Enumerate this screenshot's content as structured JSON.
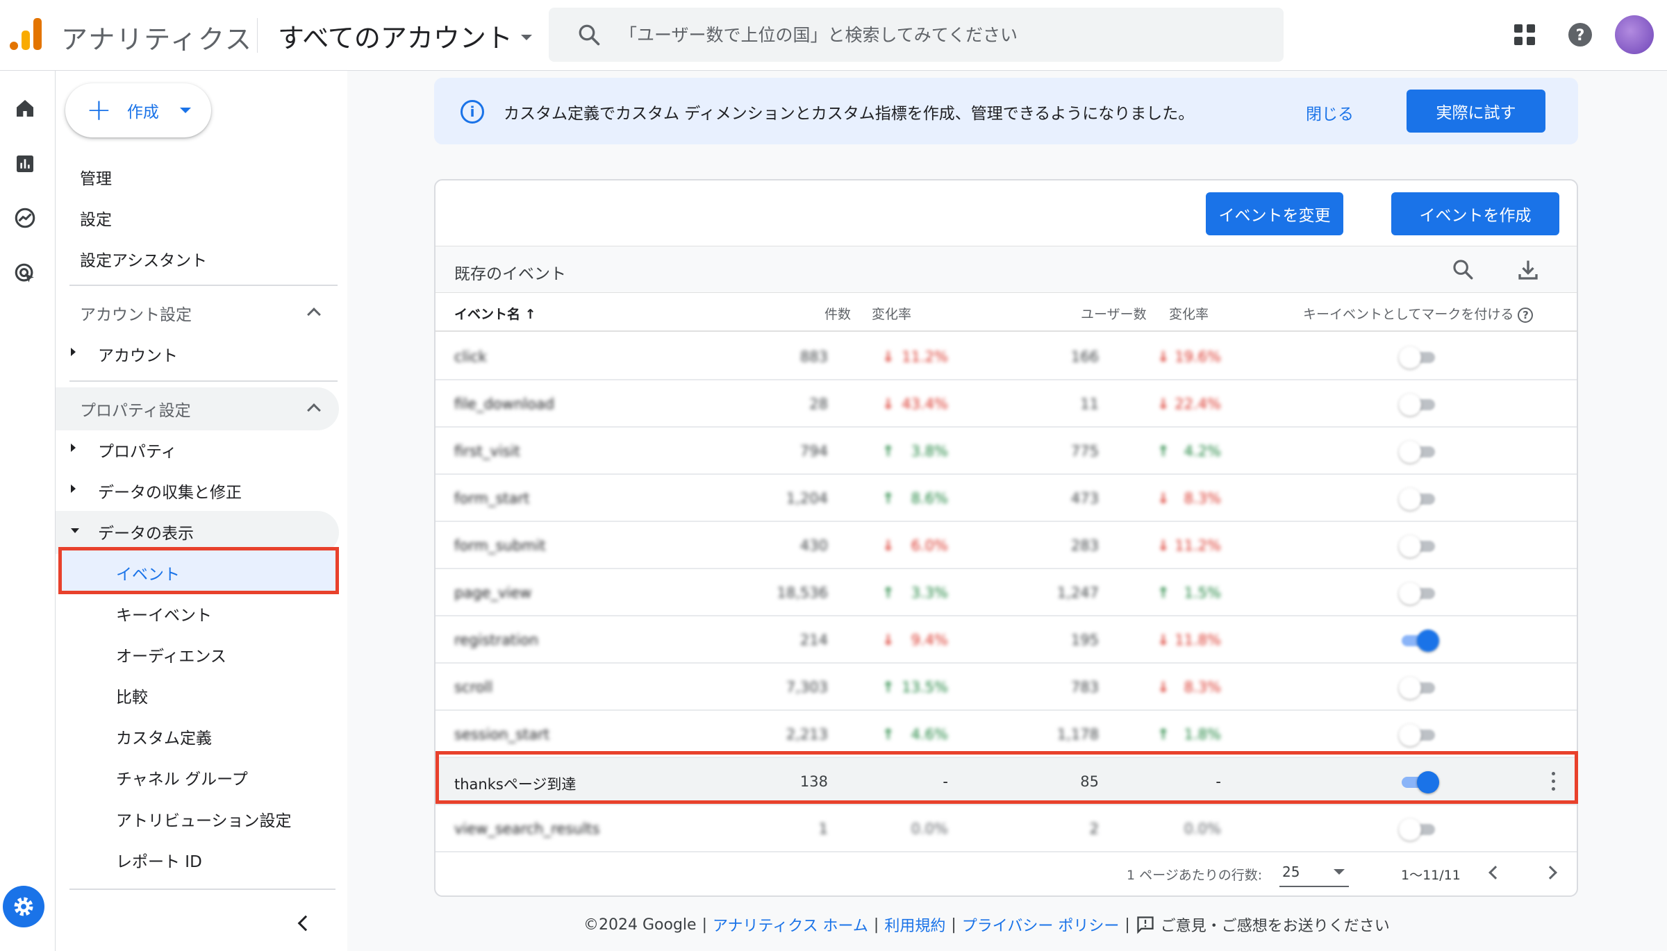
{
  "header": {
    "app_title": "アナリティクス",
    "account_picker": "すべてのアカウント",
    "search_placeholder": "「ユーザー数で上位の国」と検索してみてください"
  },
  "sidenav": {
    "create_label": "作成",
    "top_items": [
      "管理",
      "設定",
      "設定アシスタント"
    ],
    "account_section": "アカウント設定",
    "account_items": [
      "アカウント"
    ],
    "property_section": "プロパティ設定",
    "property_items": [
      "プロパティ",
      "データの収集と修正",
      "データの表示"
    ],
    "display_items": [
      "イベント",
      "キーイベント",
      "オーディエンス",
      "比較",
      "カスタム定義",
      "チャネル グループ",
      "アトリビューション設定",
      "レポート ID"
    ]
  },
  "banner": {
    "message": "カスタム定義でカスタム ディメンションとカスタム指標を作成、管理できるようになりました。",
    "close_label": "閉じる",
    "try_label": "実際に試す"
  },
  "events_card": {
    "modify_button": "イベントを変更",
    "create_button": "イベントを作成",
    "section_title": "既存のイベント",
    "columns": {
      "name": "イベント名",
      "count": "件数",
      "count_change": "変化率",
      "users": "ユーザー数",
      "users_change": "変化率",
      "key_event": "キーイベントとしてマークを付ける"
    },
    "rows": [
      {
        "name": "click",
        "count": "883",
        "count_dir": "down",
        "count_change": "11.2%",
        "users": "166",
        "users_dir": "down",
        "users_change": "19.6%",
        "key_event": false
      },
      {
        "name": "file_download",
        "count": "28",
        "count_dir": "down",
        "count_change": "43.4%",
        "users": "11",
        "users_dir": "down",
        "users_change": "22.4%",
        "key_event": false
      },
      {
        "name": "first_visit",
        "count": "794",
        "count_dir": "up",
        "count_change": "3.8%",
        "users": "775",
        "users_dir": "up",
        "users_change": "4.2%",
        "key_event": false
      },
      {
        "name": "form_start",
        "count": "1,204",
        "count_dir": "up",
        "count_change": "8.6%",
        "users": "473",
        "users_dir": "down",
        "users_change": "8.3%",
        "key_event": false
      },
      {
        "name": "form_submit",
        "count": "430",
        "count_dir": "down",
        "count_change": "6.0%",
        "users": "283",
        "users_dir": "down",
        "users_change": "11.2%",
        "key_event": false
      },
      {
        "name": "page_view",
        "count": "18,536",
        "count_dir": "up",
        "count_change": "3.3%",
        "users": "1,247",
        "users_dir": "up",
        "users_change": "1.5%",
        "key_event": false
      },
      {
        "name": "registration",
        "count": "214",
        "count_dir": "down",
        "count_change": "9.4%",
        "users": "195",
        "users_dir": "down",
        "users_change": "11.8%",
        "key_event": true
      },
      {
        "name": "scroll",
        "count": "7,303",
        "count_dir": "up",
        "count_change": "13.5%",
        "users": "783",
        "users_dir": "down",
        "users_change": "8.3%",
        "key_event": false
      },
      {
        "name": "session_start",
        "count": "2,213",
        "count_dir": "up",
        "count_change": "4.6%",
        "users": "1,178",
        "users_dir": "up",
        "users_change": "1.8%",
        "key_event": false
      },
      {
        "name": "thanksページ到達",
        "count": "138",
        "count_dir": "none",
        "count_change": "-",
        "users": "85",
        "users_dir": "none",
        "users_change": "-",
        "key_event": true
      },
      {
        "name": "view_search_results",
        "count": "1",
        "count_dir": "none",
        "count_change": "0.0%",
        "users": "2",
        "users_dir": "none",
        "users_change": "0.0%",
        "key_event": false
      }
    ],
    "rows_per_page_label": "1 ページあたりの行数:",
    "rows_per_page": "25",
    "range": "1〜11/11"
  },
  "footer": {
    "copyright": "©2024 Google",
    "links": [
      "アナリティクス ホーム",
      "利用規約",
      "プライバシー ポリシー"
    ],
    "feedback": "ご意見・ご感想をお送りください"
  },
  "colors": {
    "accent": "#1a73e8",
    "highlight": "#e8412c",
    "up": "#188038",
    "down": "#d93025"
  },
  "icons": [
    "home-icon",
    "reports-icon",
    "explore-icon",
    "advertising-icon",
    "settings-icon",
    "apps-icon",
    "help-icon",
    "search-icon",
    "download-icon",
    "info-icon",
    "feedback-icon"
  ]
}
